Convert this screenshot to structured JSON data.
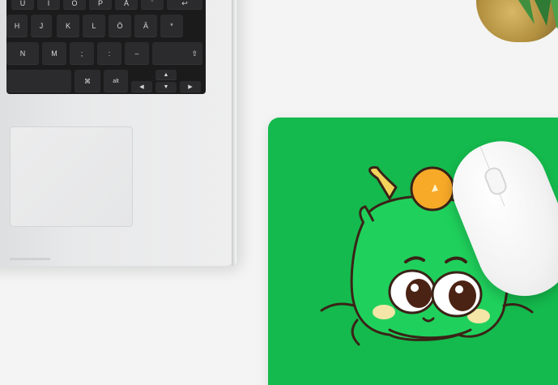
{
  "keyboard": {
    "row1": [
      "U",
      "I",
      "O",
      "P",
      "Å",
      "¨",
      "↩"
    ],
    "row2": [
      "H",
      "J",
      "K",
      "L",
      "Ö",
      "Ä",
      "*"
    ],
    "row3": [
      "N",
      "M",
      ";",
      ":",
      "–",
      "⇧"
    ],
    "row4": [
      "⌘",
      "cmd",
      "alt",
      "⌥",
      "◀",
      "▲",
      "▼",
      "▶"
    ]
  },
  "colors": {
    "mousepad": "#14ba4d",
    "dragon_face": "#1fd15c",
    "pearl": "#f7a928",
    "outline": "#3a2317"
  }
}
